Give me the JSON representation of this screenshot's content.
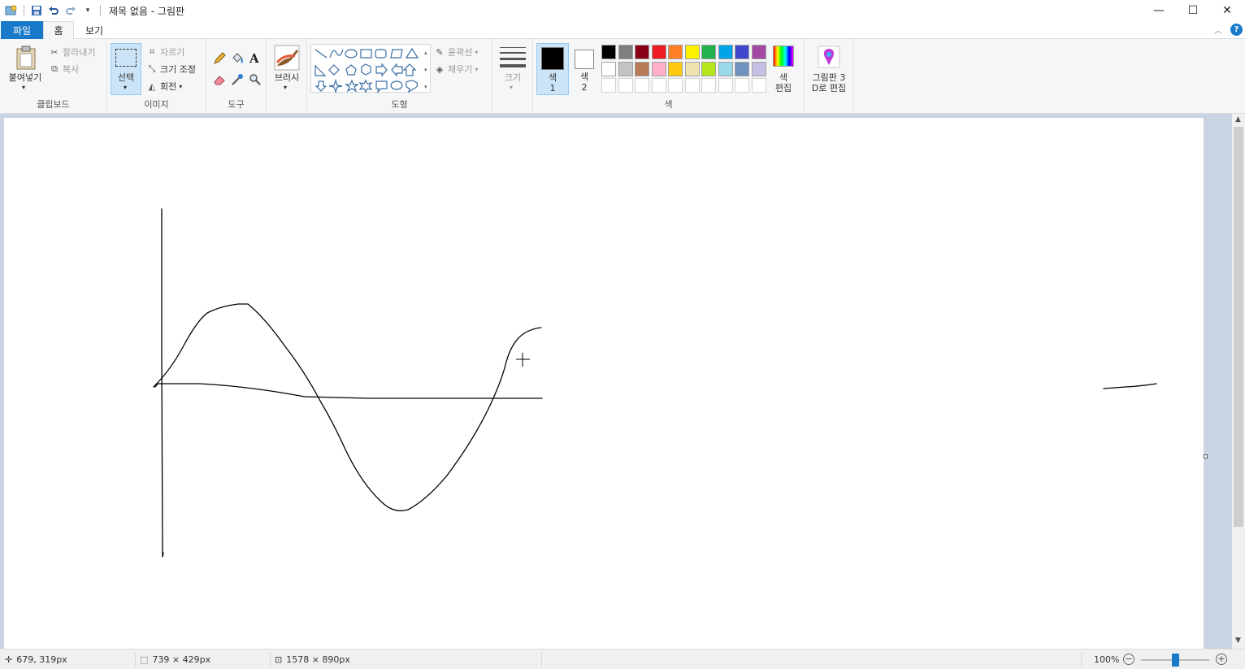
{
  "window": {
    "title": "제목 없음 - 그림판",
    "minimize": "—",
    "maximize": "☐",
    "close": "✕"
  },
  "tabs": {
    "file": "파일",
    "home": "홈",
    "view": "보기"
  },
  "clipboard": {
    "paste": "붙여넣기",
    "cut": "잘라내기",
    "copy": "복사",
    "label": "클립보드"
  },
  "image": {
    "select": "선택",
    "crop": "자르기",
    "resize": "크기 조정",
    "rotate": "회전",
    "label": "이미지"
  },
  "tools": {
    "text_glyph": "A",
    "label": "도구"
  },
  "brushes": {
    "label": "브러시"
  },
  "shapes": {
    "outline": "윤곽선",
    "fill": "채우기",
    "label": "도형"
  },
  "size": {
    "label": "크기"
  },
  "colors": {
    "color1_line1": "색",
    "color1_line2": "1",
    "color2_line1": "색",
    "color2_line2": "2",
    "edit_line1": "색",
    "edit_line2": "편집",
    "label": "색",
    "palette_row1": [
      "#000000",
      "#7f7f7f",
      "#880015",
      "#ed1c24",
      "#ff7f27",
      "#fff200",
      "#22b14c",
      "#00a2e8",
      "#3f48cc",
      "#a349a4"
    ],
    "palette_row2": [
      "#ffffff",
      "#c3c3c3",
      "#b97a57",
      "#ffaec9",
      "#ffc90e",
      "#efe4b0",
      "#b5e61d",
      "#99d9ea",
      "#7092be",
      "#c8bfe7"
    ],
    "color1": "#000000",
    "color2": "#ffffff"
  },
  "paint3d": {
    "line1": "그림판 3",
    "line2": "D로 편집"
  },
  "status": {
    "cursor": "679, 319px",
    "selection": "739 × 429px",
    "canvas_size": "1578 × 890px",
    "zoom": "100%",
    "zoom_level": 0.5
  }
}
